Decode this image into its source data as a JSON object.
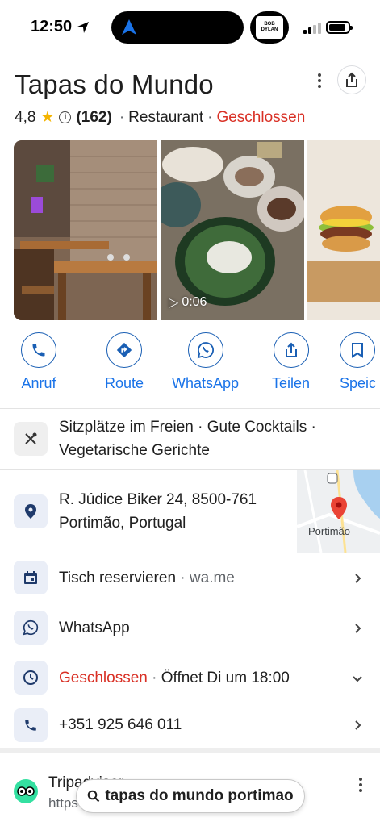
{
  "status_bar": {
    "time": "12:50",
    "icons": [
      "location-arrow-icon",
      "navigation-icon",
      "cellular-signal-icon",
      "battery-icon"
    ],
    "now_playing_art_text": "BOB DYLAN"
  },
  "place": {
    "name": "Tapas do Mundo",
    "rating": "4,8",
    "review_count": "(162)",
    "category": "Restaurant",
    "status": "Geschlossen",
    "separator": "·"
  },
  "photos": [
    {
      "name": "interior-photo"
    },
    {
      "name": "food-video",
      "duration": "0:06"
    },
    {
      "name": "burger-photo"
    }
  ],
  "actions": [
    {
      "label": "Anruf",
      "icon": "phone-icon"
    },
    {
      "label": "Route",
      "icon": "directions-icon"
    },
    {
      "label": "WhatsApp",
      "icon": "whatsapp-icon"
    },
    {
      "label": "Teilen",
      "icon": "share-icon"
    },
    {
      "label": "Speic",
      "icon": "bookmark-icon"
    }
  ],
  "rows": {
    "features": {
      "line1": "Sitzplätze im Freien · Gute Cocktails ·",
      "line2": "Vegetarische Gerichte"
    },
    "address": {
      "line1": "R. Júdice Biker 24, 8500-761",
      "line2": "Portimão, Portugal",
      "map_label": "Portimão"
    },
    "reserve": {
      "label": "Tisch reservieren",
      "separator": "·",
      "source": "wa.me"
    },
    "whatsapp": {
      "label": "WhatsApp"
    },
    "hours": {
      "status": "Geschlossen",
      "separator": "·",
      "opens": "Öffnet Di um 18:00"
    },
    "phone": {
      "number": "+351 925 646 011"
    }
  },
  "bottom": {
    "source_name": "Tripadvisor",
    "source_url": "https",
    "search_query": "tapas do mundo portimao"
  },
  "colors": {
    "accent_blue": "#1a73e8",
    "closed_red": "#d93025",
    "star_yellow": "#f4b400",
    "icon_bg": "#eaeef7"
  }
}
